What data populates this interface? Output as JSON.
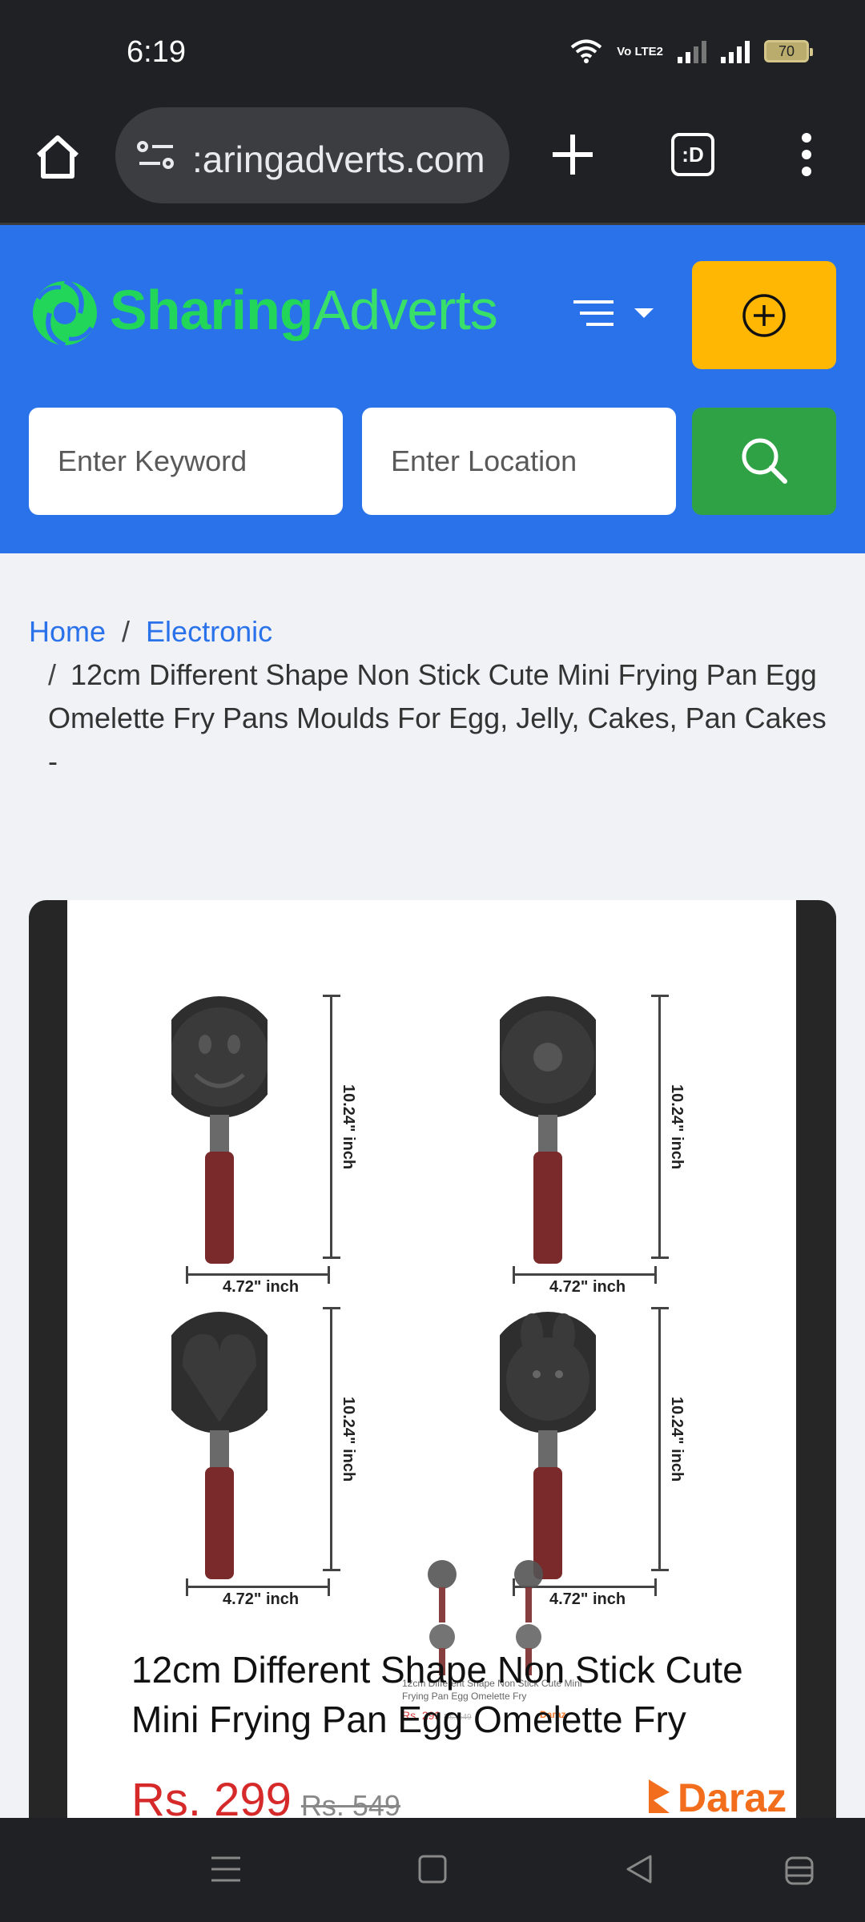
{
  "status_bar": {
    "time": "6:19",
    "volte": "Vo LTE2",
    "battery": "70"
  },
  "browser": {
    "url": ":aringadverts.com",
    "tabs_label": ":D"
  },
  "header": {
    "logo_part1": "Sharing",
    "logo_part2": "Adverts",
    "keyword_placeholder": "Enter Keyword",
    "location_placeholder": "Enter Location"
  },
  "breadcrumb": {
    "home": "Home",
    "category": "Electronic",
    "current": "12cm Different Shape Non Stick Cute Mini Frying Pan Egg Omelette Fry Pans Moulds For Egg, Jelly, Cakes, Pan Cakes -"
  },
  "product_image": {
    "dim_width": "4.72\" inch",
    "dim_height": "10.24\" inch",
    "title": "12cm Different Shape Non Stick Cute Mini Frying Pan Egg Omelette Fry",
    "price": "Rs. 299",
    "old_price": "Rs. 549",
    "brand": "Daraz",
    "mini_title": "12cm Different Shape Non Stick Cute Mini Frying Pan Egg Omelette Fry",
    "mini_price": "Rs. 299",
    "mini_old_price": "Rs. 549",
    "mini_brand": "Daraz"
  },
  "colors": {
    "header_blue": "#2a72ea",
    "logo_green": "#22d65a",
    "post_yellow": "#ffb703",
    "search_green": "#2fa246",
    "price_red": "#d62a2a"
  },
  "icons": [
    "home-icon",
    "site-info-icon",
    "new-tab-icon",
    "tab-switcher-icon",
    "overflow-menu-icon",
    "menu-icon",
    "add-circle-icon",
    "search-icon"
  ]
}
